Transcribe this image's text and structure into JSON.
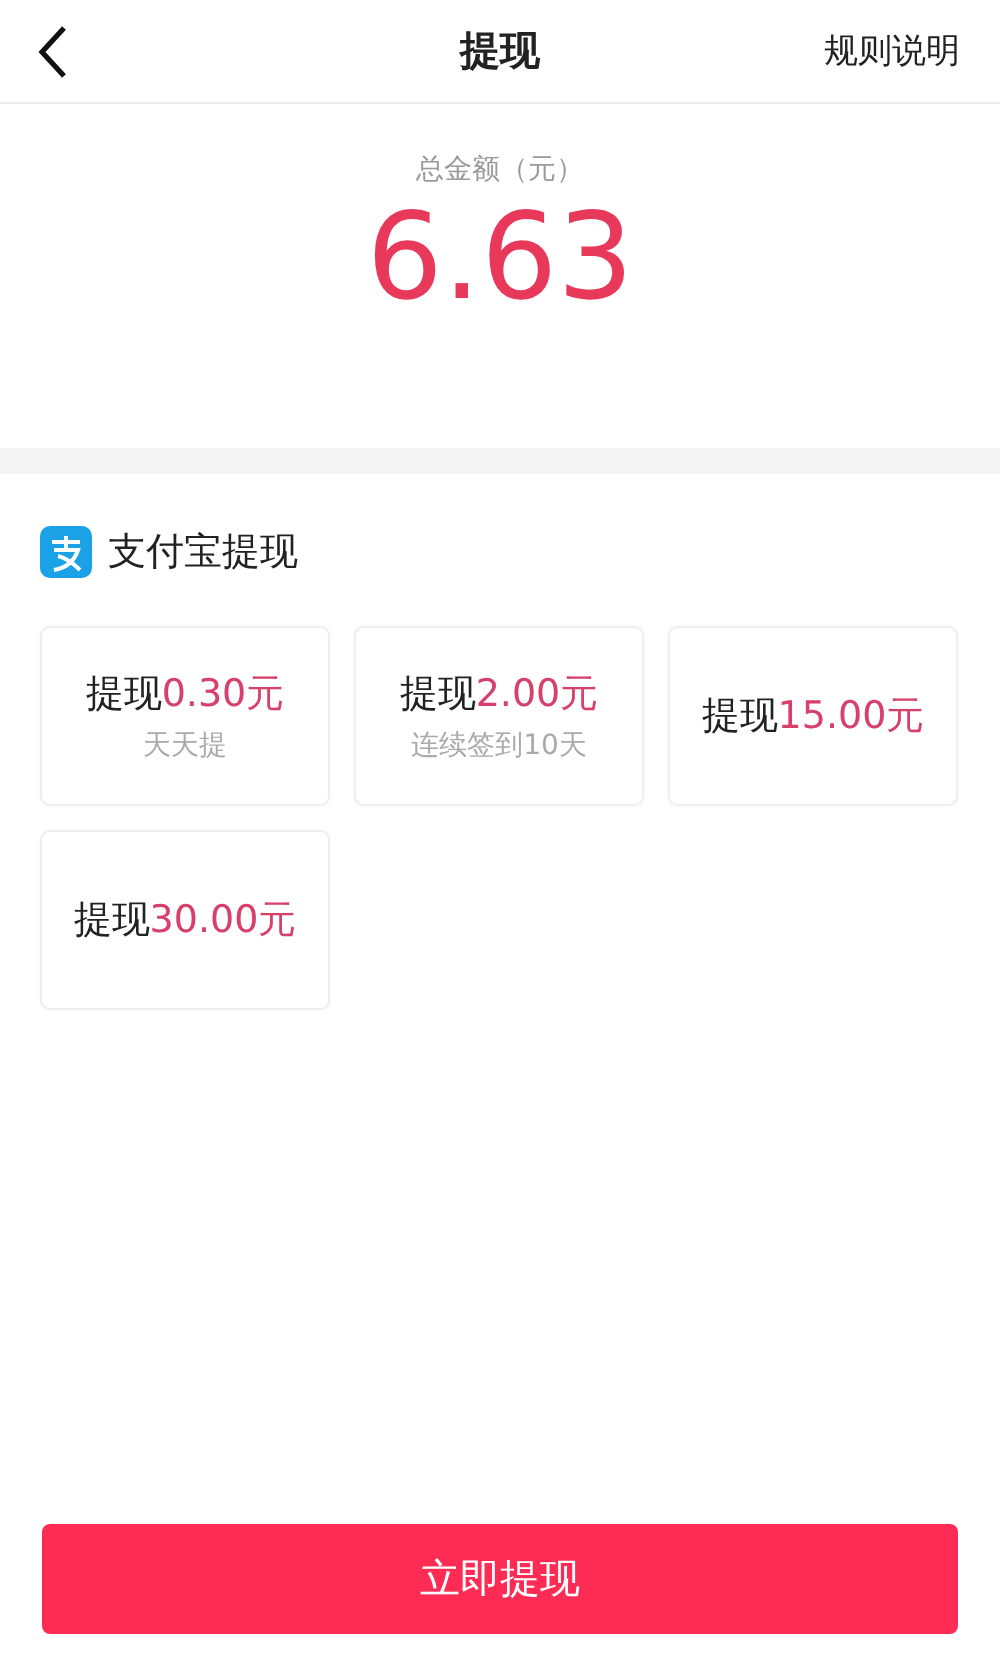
{
  "header": {
    "title": "提现",
    "action": "规则说明"
  },
  "balance": {
    "label": "总金额（元）",
    "amount": "6.63"
  },
  "section": {
    "title": "支付宝提现"
  },
  "options": [
    {
      "label": "提现",
      "amount": "0.30元",
      "note": "天天提"
    },
    {
      "label": "提现",
      "amount": "2.00元",
      "note": "连续签到10天"
    },
    {
      "label": "提现",
      "amount": "15.00元"
    },
    {
      "label": "提现",
      "amount": "30.00元"
    }
  ],
  "submit": "立即提现"
}
